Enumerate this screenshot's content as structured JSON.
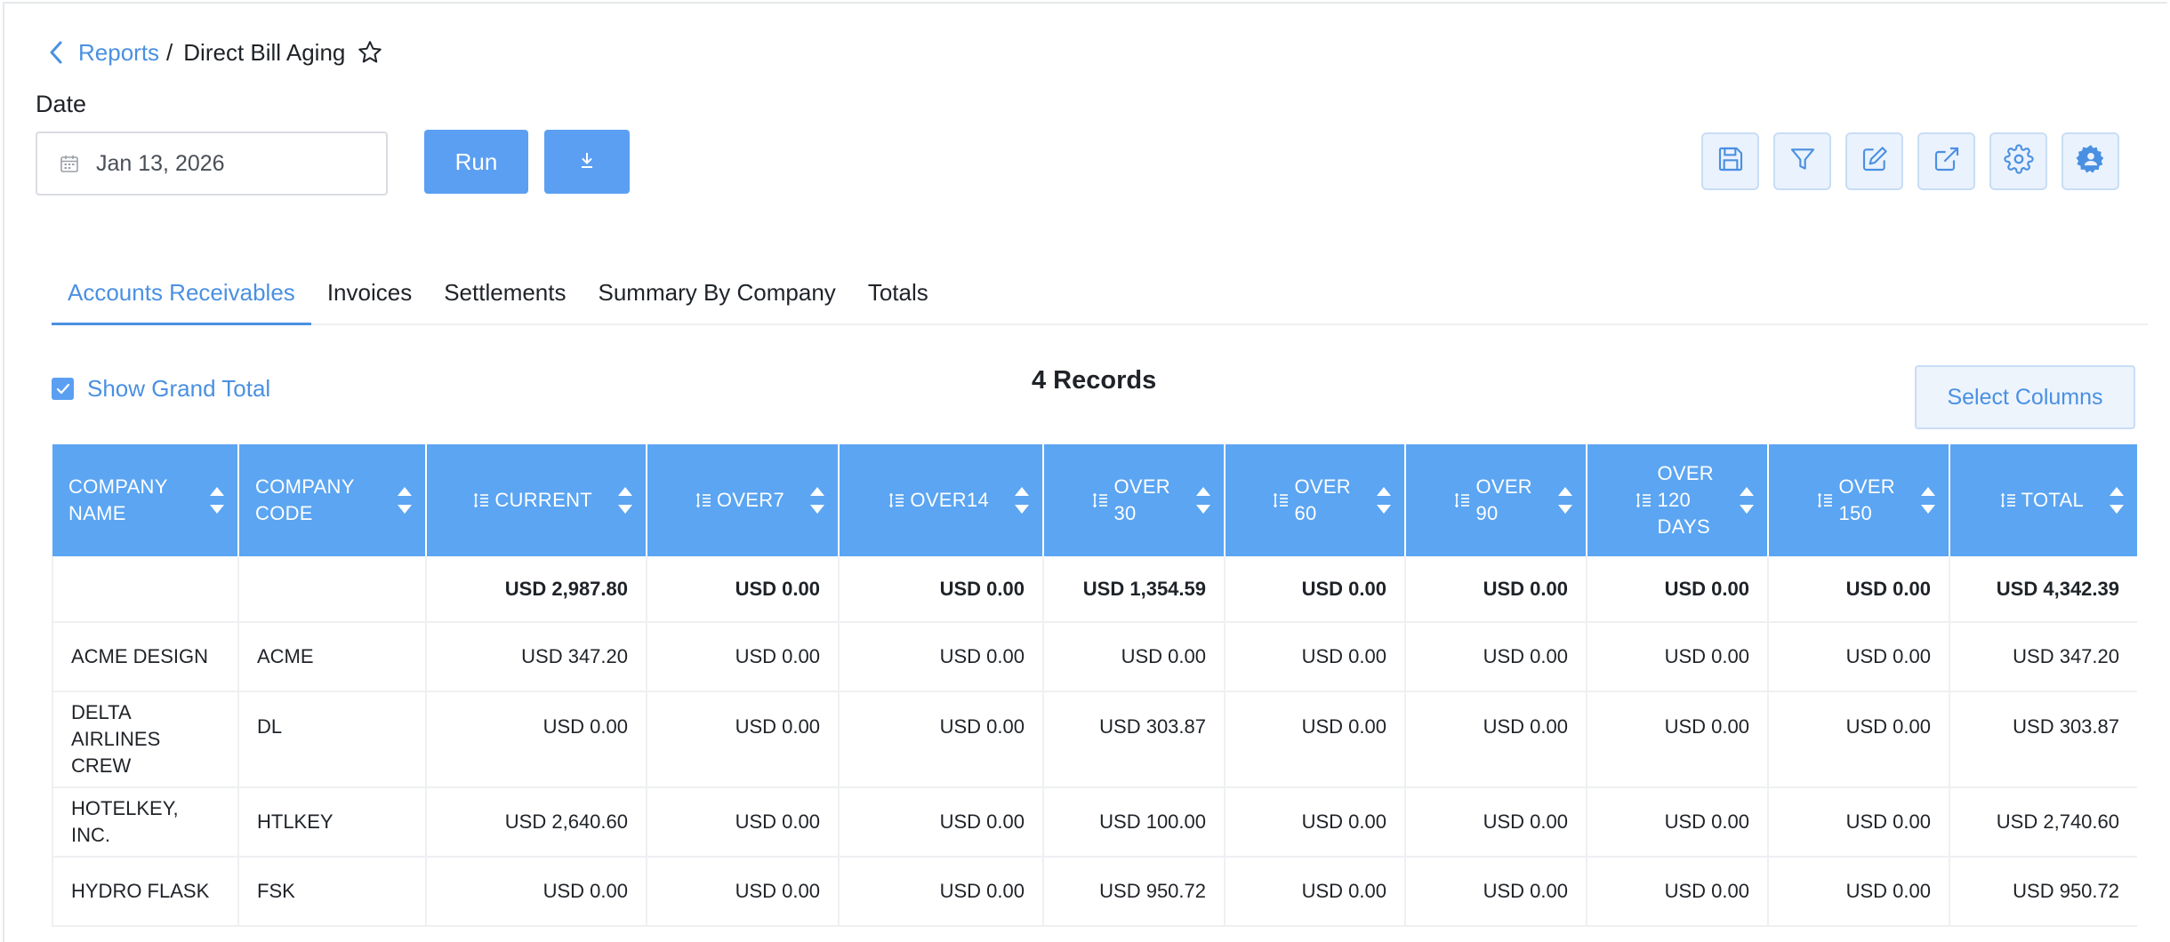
{
  "breadcrumb": {
    "parent": "Reports",
    "separator": "/",
    "current": "Direct Bill Aging"
  },
  "date": {
    "label": "Date",
    "value": "Jan 13, 2026"
  },
  "actions": {
    "run": "Run"
  },
  "toolbar": [
    "save-icon",
    "filter-icon",
    "edit-icon",
    "external-link-icon",
    "settings-icon",
    "admin-settings-icon"
  ],
  "tabs": [
    {
      "label": "Accounts Receivables",
      "active": true
    },
    {
      "label": "Invoices",
      "active": false
    },
    {
      "label": "Settlements",
      "active": false
    },
    {
      "label": "Summary By Company",
      "active": false
    },
    {
      "label": "Totals",
      "active": false
    }
  ],
  "grand_total": {
    "label": "Show Grand Total",
    "checked": true
  },
  "records_label": "4 Records",
  "select_columns": "Select Columns",
  "table": {
    "columns": [
      {
        "l1": "COMPANY",
        "l2": "NAME",
        "l3": ""
      },
      {
        "l1": "COMPANY",
        "l2": "CODE",
        "l3": ""
      },
      {
        "l1": "CURRENT",
        "l2": "",
        "l3": ""
      },
      {
        "l1": "OVER7",
        "l2": "",
        "l3": ""
      },
      {
        "l1": "OVER14",
        "l2": "",
        "l3": ""
      },
      {
        "l1": "OVER",
        "l2": "30",
        "l3": ""
      },
      {
        "l1": "OVER",
        "l2": "60",
        "l3": ""
      },
      {
        "l1": "OVER",
        "l2": "90",
        "l3": ""
      },
      {
        "l1": "OVER",
        "l2": "120",
        "l3": "DAYS"
      },
      {
        "l1": "OVER",
        "l2": "150",
        "l3": ""
      },
      {
        "l1": "TOTAL",
        "l2": "",
        "l3": ""
      }
    ],
    "totals": [
      "",
      "",
      "USD 2,987.80",
      "USD 0.00",
      "USD 0.00",
      "USD 1,354.59",
      "USD 0.00",
      "USD 0.00",
      "USD 0.00",
      "USD 0.00",
      "USD 4,342.39"
    ],
    "rows": [
      {
        "name_l1": "ACME DESIGN",
        "name_l2": "",
        "code": "ACME",
        "values": [
          "USD 347.20",
          "USD 0.00",
          "USD 0.00",
          "USD 0.00",
          "USD 0.00",
          "USD 0.00",
          "USD 0.00",
          "USD 0.00",
          "USD 347.20"
        ]
      },
      {
        "name_l1": "DELTA AIRLINES",
        "name_l2": "CREW",
        "code": "DL",
        "values": [
          "USD 0.00",
          "USD 0.00",
          "USD 0.00",
          "USD 303.87",
          "USD 0.00",
          "USD 0.00",
          "USD 0.00",
          "USD 0.00",
          "USD 303.87"
        ]
      },
      {
        "name_l1": "HOTELKEY, INC.",
        "name_l2": "",
        "code": "HTLKEY",
        "values": [
          "USD 2,640.60",
          "USD 0.00",
          "USD 0.00",
          "USD 100.00",
          "USD 0.00",
          "USD 0.00",
          "USD 0.00",
          "USD 0.00",
          "USD 2,740.60"
        ]
      },
      {
        "name_l1": "HYDRO FLASK",
        "name_l2": "",
        "code": "FSK",
        "values": [
          "USD 0.00",
          "USD 0.00",
          "USD 0.00",
          "USD 950.72",
          "USD 0.00",
          "USD 0.00",
          "USD 0.00",
          "USD 0.00",
          "USD 950.72"
        ]
      }
    ]
  },
  "colors": {
    "accent": "#4a90e2",
    "header_bg": "#5ba5f2",
    "button_bg": "#5b9ff2"
  }
}
